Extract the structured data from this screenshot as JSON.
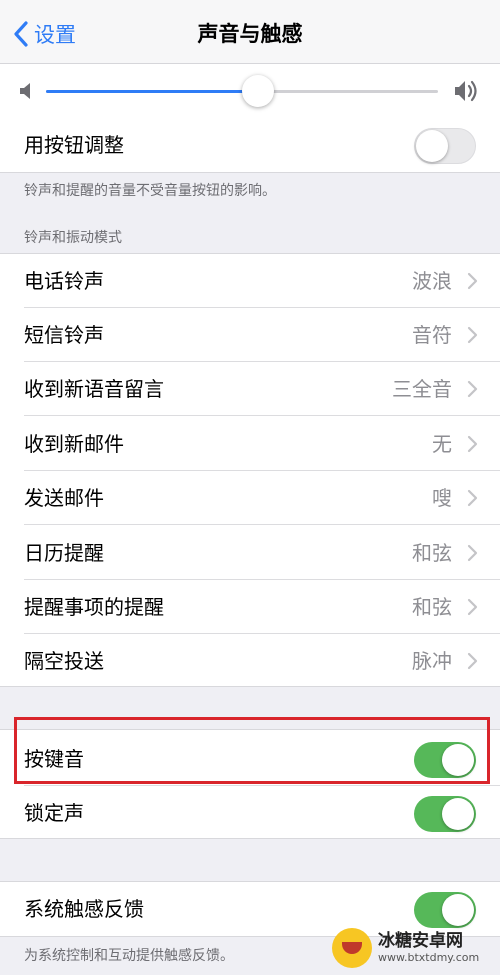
{
  "nav": {
    "back_label": "设置",
    "title": "声音与触感"
  },
  "volume": {
    "level": 0.54
  },
  "change_with_buttons": {
    "label": "用按钮调整",
    "on": false,
    "footnote": "铃声和提醒的音量不受音量按钮的影响。"
  },
  "section_header": "铃声和振动模式",
  "sounds": [
    {
      "label": "电话铃声",
      "value": "波浪"
    },
    {
      "label": "短信铃声",
      "value": "音符"
    },
    {
      "label": "收到新语音留言",
      "value": "三全音"
    },
    {
      "label": "收到新邮件",
      "value": "无"
    },
    {
      "label": "发送邮件",
      "value": "嗖"
    },
    {
      "label": "日历提醒",
      "value": "和弦"
    },
    {
      "label": "提醒事项的提醒",
      "value": "和弦"
    },
    {
      "label": "隔空投送",
      "value": "脉冲"
    }
  ],
  "keyboard_clicks": {
    "label": "按键音",
    "on": true
  },
  "lock_sound": {
    "label": "锁定声",
    "on": true
  },
  "haptics": {
    "label": "系统触感反馈",
    "on": true,
    "footnote": "为系统控制和互动提供触感反馈。"
  },
  "watermark": {
    "title": "冰糖安卓网",
    "url": "www.btxtdmy.com"
  },
  "colors": {
    "accent": "#2f7cf6",
    "toggle_on": "#56b859",
    "highlight": "#d9252b"
  }
}
